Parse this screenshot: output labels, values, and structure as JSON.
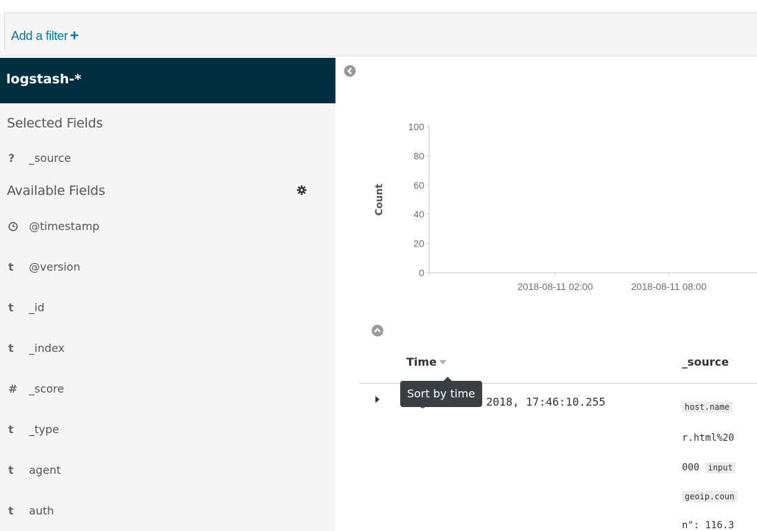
{
  "filter_bar": {
    "add_filter_label": "Add a filter",
    "add_icon": "plus-icon"
  },
  "sidebar": {
    "index_pattern": "logstash-*",
    "selected_title": "Selected Fields",
    "selected_fields": [
      {
        "type": "?",
        "name": "_source"
      }
    ],
    "available_title": "Available Fields",
    "settings_icon": "gear-icon",
    "available_fields": [
      {
        "type": "clock",
        "name": "@timestamp"
      },
      {
        "type": "t",
        "name": "@version"
      },
      {
        "type": "t",
        "name": "_id"
      },
      {
        "type": "t",
        "name": "_index"
      },
      {
        "type": "#",
        "name": "_score"
      },
      {
        "type": "t",
        "name": "_type"
      },
      {
        "type": "t",
        "name": "agent"
      },
      {
        "type": "t",
        "name": "auth"
      }
    ]
  },
  "chart_data": {
    "type": "bar",
    "ylabel": "Count",
    "y_ticks": [
      0,
      20,
      40,
      60,
      80,
      100
    ],
    "ylim": [
      0,
      100
    ],
    "x_ticks": [
      "2018-08-11 02:00",
      "2018-08-11 08:00"
    ],
    "series": [
      {
        "values": []
      }
    ],
    "grid": false
  },
  "table": {
    "columns": {
      "time": "Time",
      "source": "_source"
    },
    "tooltip": "Sort by time",
    "rows": [
      {
        "time": "August 11th 2018, 17:46:10.255",
        "source_lines": [
          {
            "key": "host.name",
            "text": ""
          },
          {
            "key": "",
            "text": "r.html%20"
          },
          {
            "key": "input",
            "text": "000 "
          },
          {
            "key": "geoip.coun",
            "text": ""
          },
          {
            "key": "",
            "text": "n\": 116.3"
          }
        ]
      }
    ]
  }
}
